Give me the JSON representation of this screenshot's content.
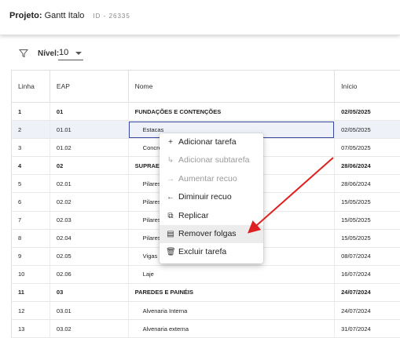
{
  "header": {
    "label": "Projeto:",
    "project_name": "Gantt Italo",
    "project_id": "ID - 26335"
  },
  "toolbar": {
    "filter_icon": "filter-icon",
    "level_label": "Nível:",
    "level_value": "10"
  },
  "table": {
    "columns": [
      "Linha",
      "EAP",
      "Nome",
      "Início"
    ],
    "rows": [
      {
        "linha": "1",
        "eap": "01",
        "nome": "FUNDAÇÕES E CONTENÇÕES",
        "inicio": "02/05/2025",
        "group": true
      },
      {
        "linha": "2",
        "eap": "01.01",
        "nome": "Estacas",
        "inicio": "02/05/2025",
        "group": false
      },
      {
        "linha": "3",
        "eap": "01.02",
        "nome": "Concret",
        "inicio": "07/05/2025",
        "group": false
      },
      {
        "linha": "4",
        "eap": "02",
        "nome": "SUPRAEST",
        "inicio": "28/06/2024",
        "group": true
      },
      {
        "linha": "5",
        "eap": "02.01",
        "nome": "Pilares",
        "inicio": "28/06/2024",
        "group": false
      },
      {
        "linha": "6",
        "eap": "02.02",
        "nome": "Pilares x",
        "inicio": "15/05/2025",
        "group": false
      },
      {
        "linha": "7",
        "eap": "02.03",
        "nome": "Pilares x",
        "inicio": "15/05/2025",
        "group": false
      },
      {
        "linha": "8",
        "eap": "02.04",
        "nome": "Pilares y",
        "inicio": "15/05/2025",
        "group": false
      },
      {
        "linha": "9",
        "eap": "02.05",
        "nome": "Vigas",
        "inicio": "08/07/2024",
        "group": false
      },
      {
        "linha": "10",
        "eap": "02.06",
        "nome": "Laje",
        "inicio": "16/07/2024",
        "group": false
      },
      {
        "linha": "11",
        "eap": "03",
        "nome": "PAREDES E PAINÉIS",
        "inicio": "24/07/2024",
        "group": true
      },
      {
        "linha": "12",
        "eap": "03.01",
        "nome": "Alvenaria Interna",
        "inicio": "24/07/2024",
        "group": false
      },
      {
        "linha": "13",
        "eap": "03.02",
        "nome": "Alvenaria externa",
        "inicio": "31/07/2024",
        "group": false
      }
    ]
  },
  "context_menu": {
    "items": [
      {
        "label": "Adicionar tarefa",
        "icon": "plus-icon",
        "glyph": "+",
        "disabled": false
      },
      {
        "label": "Adicionar subtarefa",
        "icon": "subtask-icon",
        "glyph": "↳",
        "disabled": true
      },
      {
        "label": "Aumentar recuo",
        "icon": "arrow-right-icon",
        "glyph": "→",
        "disabled": true
      },
      {
        "label": "Diminuir recuo",
        "icon": "arrow-left-icon",
        "glyph": "←",
        "disabled": false
      },
      {
        "label": "Replicar",
        "icon": "copy-icon",
        "glyph": "⧉",
        "disabled": false
      },
      {
        "label": "Remover folgas",
        "icon": "calendar-icon",
        "glyph": "▤",
        "disabled": false
      },
      {
        "label": "Excluir tarefa",
        "icon": "trash-icon",
        "glyph": "🗑",
        "disabled": false
      }
    ]
  },
  "annotation": {
    "arrow_color": "#e02020"
  }
}
